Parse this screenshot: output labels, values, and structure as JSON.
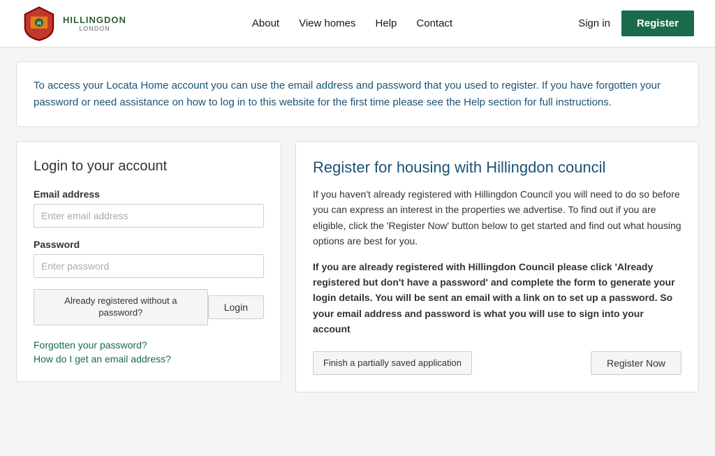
{
  "header": {
    "logo_text": "HILLINGDON",
    "logo_sub": "LONDON",
    "nav": {
      "about": "About",
      "view_homes": "View homes",
      "help": "Help",
      "contact": "Contact"
    },
    "signin": "Sign in",
    "register": "Register"
  },
  "info_box": {
    "text": "To access your Locata Home account you can use the email address and password that you used to register. If you have forgotten your password or need assistance on how to log in to this website for the first time please see the Help section for full instructions."
  },
  "login_card": {
    "title": "Login to your account",
    "email_label": "Email address",
    "email_placeholder": "Enter email address",
    "password_label": "Password",
    "password_placeholder": "Enter password",
    "already_registered_btn": "Already registered without a password?",
    "login_btn": "Login",
    "forgotten_password": "Forgotten your password?",
    "how_to_get_email": "How do I get an email address?"
  },
  "register_card": {
    "title": "Register for housing with Hillingdon council",
    "desc1": "If you haven't already registered with Hillingdon Council you will need to do so before you can express an interest in the properties we advertise. To find out if you are eligible, click the 'Register Now' button below to get started and find out what housing options are best for you.",
    "desc2_bold": "If you are already registered with Hillingdon Council please click 'Already registered but don't have a password' and complete the form to generate your login details. You will be sent an email with a link on to set up a password.  So your email address and password is what you will use to sign into your account",
    "finish_btn": "Finish a partially saved application",
    "register_now_btn": "Register Now"
  }
}
